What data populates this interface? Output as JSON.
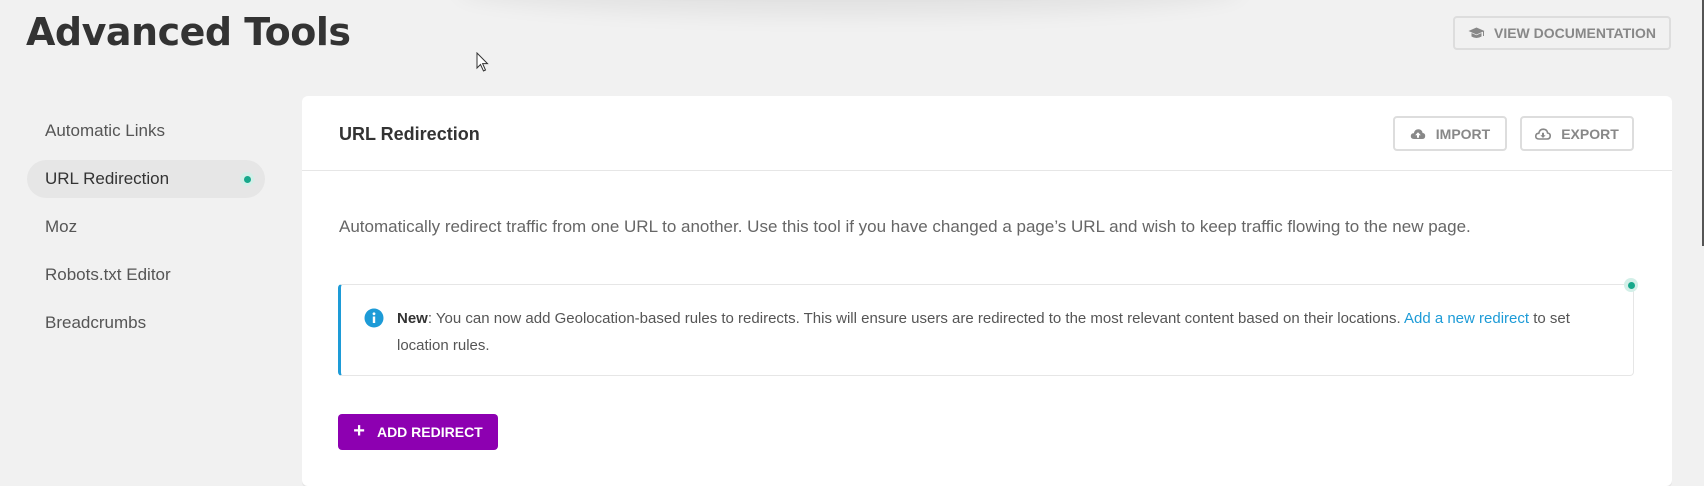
{
  "page": {
    "title": "Advanced Tools"
  },
  "header": {
    "doc_button": "VIEW DOCUMENTATION",
    "doc_icon": "graduation-cap-icon"
  },
  "sidebar": {
    "items": [
      {
        "label": "Automatic Links",
        "active": false
      },
      {
        "label": "URL Redirection",
        "active": true
      },
      {
        "label": "Moz",
        "active": false
      },
      {
        "label": "Robots.txt Editor",
        "active": false
      },
      {
        "label": "Breadcrumbs",
        "active": false
      }
    ],
    "active_dot_color": "#17a88b"
  },
  "panel": {
    "title": "URL Redirection",
    "import_label": "IMPORT",
    "export_label": "EXPORT",
    "import_icon": "cloud-upload-icon",
    "export_icon": "cloud-download-icon",
    "description": "Automatically redirect traffic from one URL to another. Use this tool if you have changed a page’s URL and wish to keep traffic flowing to the new page.",
    "notice": {
      "icon": "info-icon",
      "bold": "New",
      "text": ": You can now add Geolocation-based rules to redirects. This will ensure users are redirected to the most relevant content based on their locations. ",
      "link": "Add a new redirect",
      "after": " to set location rules.",
      "accent": "#1d9bd7"
    },
    "add_button": "ADD REDIRECT",
    "add_button_color": "#8d00b1"
  }
}
